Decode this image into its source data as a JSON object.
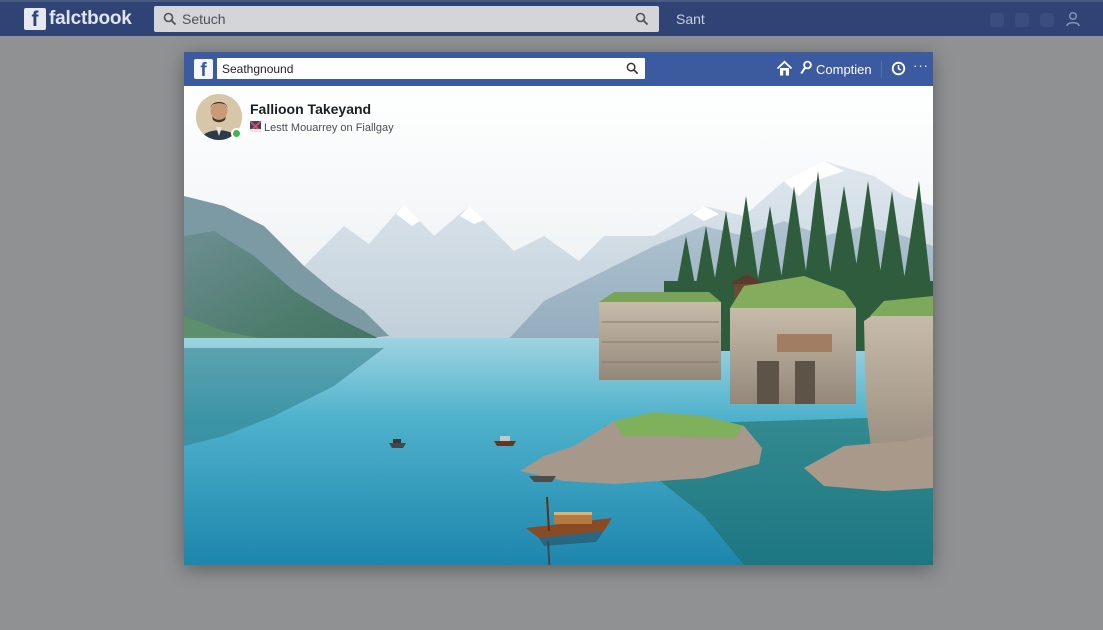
{
  "background_app": {
    "logo_letter": "f",
    "wordmark": "falctbook",
    "search_placeholder": "Setuch",
    "nav_label": "Sant",
    "icons": [
      "search-icon",
      "search-icon-right",
      "user-icon"
    ]
  },
  "window": {
    "logo_letter": "f",
    "search_value": "Seathgnound",
    "nav_label": "Comptien",
    "more_label": "···",
    "icons": [
      "search-icon",
      "home-icon",
      "pin-icon",
      "clock-icon"
    ]
  },
  "post": {
    "author": "Fallioon Takeyand",
    "meta": "Lestt Mouarrey on Fiallgay",
    "image": "mountain lake with stone ruins and boats"
  },
  "colors": {
    "outer_bar": "#2f4375",
    "inner_bar": "#3b5a9f",
    "page_bg": "#8f9193",
    "online": "#45b54b"
  }
}
